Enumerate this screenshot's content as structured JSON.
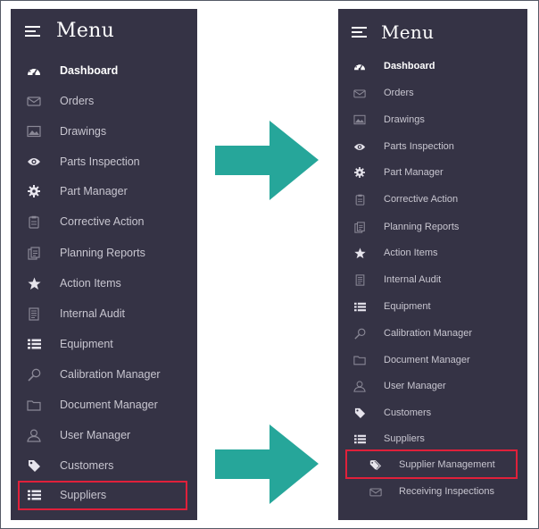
{
  "before": {
    "menu_title": "Menu",
    "items": [
      {
        "label": "Dashboard",
        "icon": "dashboard-icon"
      },
      {
        "label": "Orders",
        "icon": "envelope-icon"
      },
      {
        "label": "Drawings",
        "icon": "image-icon"
      },
      {
        "label": "Parts Inspection",
        "icon": "eye-icon"
      },
      {
        "label": "Part Manager",
        "icon": "gear-icon"
      },
      {
        "label": "Corrective Action",
        "icon": "clipboard-icon"
      },
      {
        "label": "Planning Reports",
        "icon": "report-icon"
      },
      {
        "label": "Action Items",
        "icon": "star-icon"
      },
      {
        "label": "Internal Audit",
        "icon": "document-icon"
      },
      {
        "label": "Equipment",
        "icon": "list-icon"
      },
      {
        "label": "Calibration Manager",
        "icon": "magnifier-icon"
      },
      {
        "label": "Document Manager",
        "icon": "folder-icon"
      },
      {
        "label": "User Manager",
        "icon": "user-icon"
      },
      {
        "label": "Customers",
        "icon": "tag-icon"
      },
      {
        "label": "Suppliers",
        "icon": "list-icon"
      }
    ]
  },
  "after": {
    "menu_title": "Menu",
    "items": [
      {
        "label": "Dashboard",
        "icon": "dashboard-icon"
      },
      {
        "label": "Orders",
        "icon": "envelope-icon"
      },
      {
        "label": "Drawings",
        "icon": "image-icon"
      },
      {
        "label": "Parts Inspection",
        "icon": "eye-icon"
      },
      {
        "label": "Part Manager",
        "icon": "gear-icon"
      },
      {
        "label": "Corrective Action",
        "icon": "clipboard-icon"
      },
      {
        "label": "Planning Reports",
        "icon": "report-icon"
      },
      {
        "label": "Action Items",
        "icon": "star-icon"
      },
      {
        "label": "Internal Audit",
        "icon": "document-icon"
      },
      {
        "label": "Equipment",
        "icon": "list-icon"
      },
      {
        "label": "Calibration Manager",
        "icon": "magnifier-icon"
      },
      {
        "label": "Document Manager",
        "icon": "folder-icon"
      },
      {
        "label": "User Manager",
        "icon": "user-icon"
      },
      {
        "label": "Customers",
        "icon": "tag-icon"
      },
      {
        "label": "Suppliers",
        "icon": "list-icon"
      },
      {
        "label": "Supplier Management",
        "icon": "tags-icon"
      },
      {
        "label": "Receiving Inspections",
        "icon": "inbox-icon"
      }
    ]
  },
  "colors": {
    "panel_bg": "#353345",
    "text": "#c8c6d0",
    "active_text": "#ffffff",
    "highlight_border": "#e0203a",
    "arrow": "#26a69a"
  }
}
